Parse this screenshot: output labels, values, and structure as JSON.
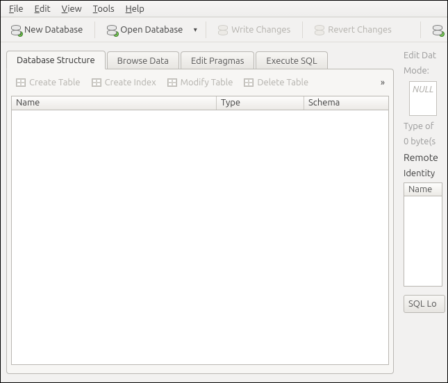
{
  "menu": {
    "file": "File",
    "edit": "Edit",
    "view": "View",
    "tools": "Tools",
    "help": "Help"
  },
  "toolbar": {
    "new_db": "New Database",
    "open_db": "Open Database",
    "write": "Write Changes",
    "revert": "Revert Changes"
  },
  "tabs": {
    "structure": "Database Structure",
    "browse": "Browse Data",
    "pragmas": "Edit Pragmas",
    "sql": "Execute SQL"
  },
  "subtool": {
    "create_table": "Create Table",
    "create_index": "Create Index",
    "modify_table": "Modify Table",
    "delete_table": "Delete Table",
    "chev": "»"
  },
  "columns": {
    "name": "Name",
    "type": "Type",
    "schema": "Schema"
  },
  "right": {
    "edit_title": "Edit Dat",
    "mode": "Mode:",
    "null": "NULL",
    "type_of": "Type of",
    "bytes": "0 byte(s",
    "remote": "Remote",
    "identity": "Identity",
    "name_header": "Name",
    "sql_btn": "SQL Lo"
  }
}
